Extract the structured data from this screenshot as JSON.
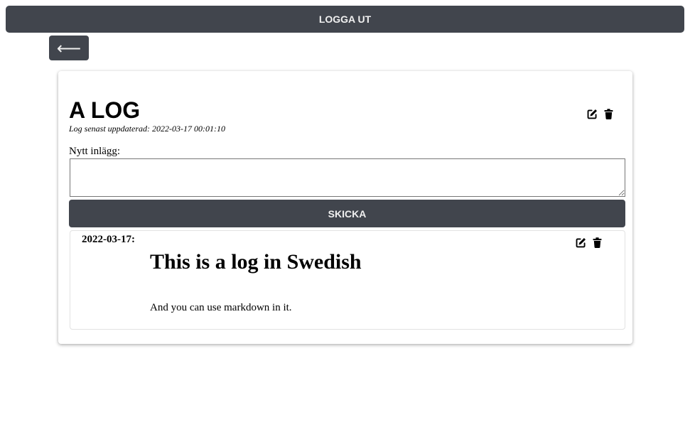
{
  "header": {
    "logout_label": "LOGGA UT"
  },
  "nav": {
    "back_label": "⟵"
  },
  "log": {
    "title": "A LOG",
    "updated": "Log senast uppdaterad: 2022-03-17 00:01:10",
    "icons": [
      "edit-icon",
      "trash-icon"
    ]
  },
  "new_entry": {
    "label": "Nytt inlägg:",
    "value": "",
    "send_label": "SKICKA"
  },
  "entries": [
    {
      "date": "2022-03-17:",
      "heading": "This is a log in Swedish",
      "body": "And you can use markdown in it.",
      "icons": [
        "edit-icon",
        "trash-icon"
      ]
    }
  ]
}
